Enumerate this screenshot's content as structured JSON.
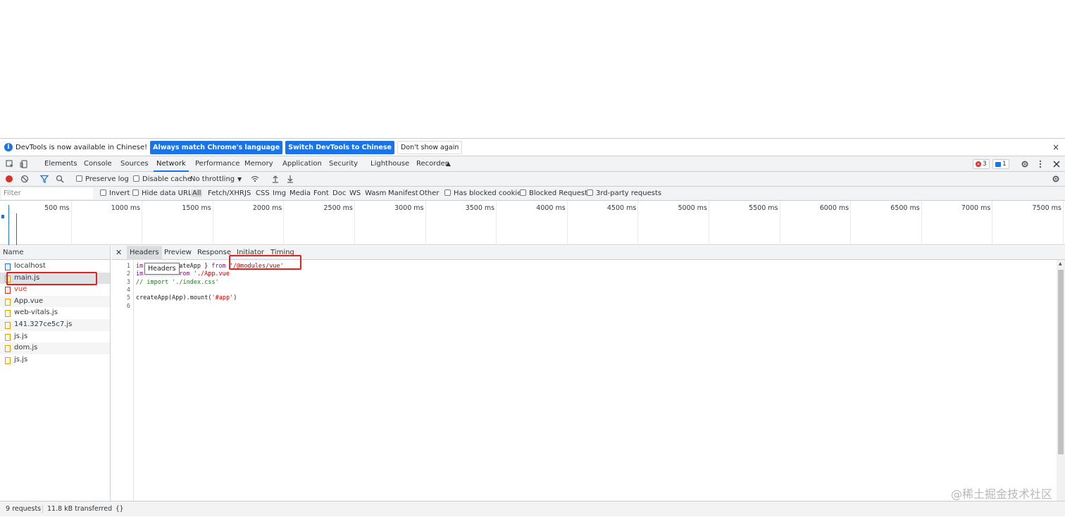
{
  "infobar": {
    "message": "DevTools is now available in Chinese!",
    "btn_match": "Always match Chrome's language",
    "btn_switch": "Switch DevTools to Chinese",
    "btn_dismiss": "Don't show again",
    "close": "×"
  },
  "tabs": [
    "Elements",
    "Console",
    "Sources",
    "Network",
    "Performance",
    "Memory",
    "Application",
    "Security",
    "Lighthouse",
    "Recorder"
  ],
  "active_tab": "Network",
  "status_counts": {
    "errors": "3",
    "messages": "1"
  },
  "network_toolbar": {
    "preserve_log": "Preserve log",
    "disable_cache": "Disable cache",
    "throttling": "No throttling"
  },
  "filter_bar": {
    "placeholder": "Filter",
    "invert": "Invert",
    "hide_data_urls": "Hide data URLs",
    "types": [
      "All",
      "Fetch/XHR",
      "JS",
      "CSS",
      "Img",
      "Media",
      "Font",
      "Doc",
      "WS",
      "Wasm",
      "Manifest",
      "Other"
    ],
    "blocked_cookies": "Has blocked cookies",
    "blocked_requests": "Blocked Requests",
    "third_party": "3rd-party requests"
  },
  "overview": {
    "ticks": [
      "500 ms",
      "1000 ms",
      "1500 ms",
      "2000 ms",
      "2500 ms",
      "3000 ms",
      "3500 ms",
      "4000 ms",
      "4500 ms",
      "5000 ms",
      "5500 ms",
      "6000 ms",
      "6500 ms",
      "7000 ms",
      "7500 ms"
    ]
  },
  "name_column": "Name",
  "requests": [
    {
      "name": "localhost",
      "type": "doc",
      "error": false
    },
    {
      "name": "main.js",
      "type": "js",
      "error": false,
      "selected": true
    },
    {
      "name": "vue",
      "type": "err",
      "error": true
    },
    {
      "name": "App.vue",
      "type": "js",
      "error": false
    },
    {
      "name": "web-vitals.js",
      "type": "js",
      "error": false
    },
    {
      "name": "141.327ce5c7.js",
      "type": "js",
      "error": false
    },
    {
      "name": "js.js",
      "type": "js",
      "error": false
    },
    {
      "name": "dom.js",
      "type": "js",
      "error": false
    },
    {
      "name": "js.js",
      "type": "js",
      "error": false
    }
  ],
  "detail_tabs": [
    "Headers",
    "Preview",
    "Response",
    "Initiator",
    "Timing"
  ],
  "detail_active_tab": "Headers",
  "tooltip": "Headers",
  "code": {
    "line_numbers": [
      "1",
      "2",
      "3",
      "4",
      "5",
      "6"
    ],
    "l1_kw1": "im",
    "l1_rest": "ateApp } ",
    "l1_kw2": "from",
    "l1_str": "'/@modules/vue'",
    "l2_kw1": "im",
    "l2_kw2": "rom",
    "l2_str": "'./App.vue",
    "l3_cmt": "// import './index.css'",
    "l5_plain": "createApp(App).mount(",
    "l5_str": "'#app'",
    "l5_end": ")"
  },
  "status_bar": {
    "requests": "9 requests",
    "transferred": "11.8 kB transferred",
    "braces": "{}"
  },
  "watermark": "@稀土掘金技术社区"
}
